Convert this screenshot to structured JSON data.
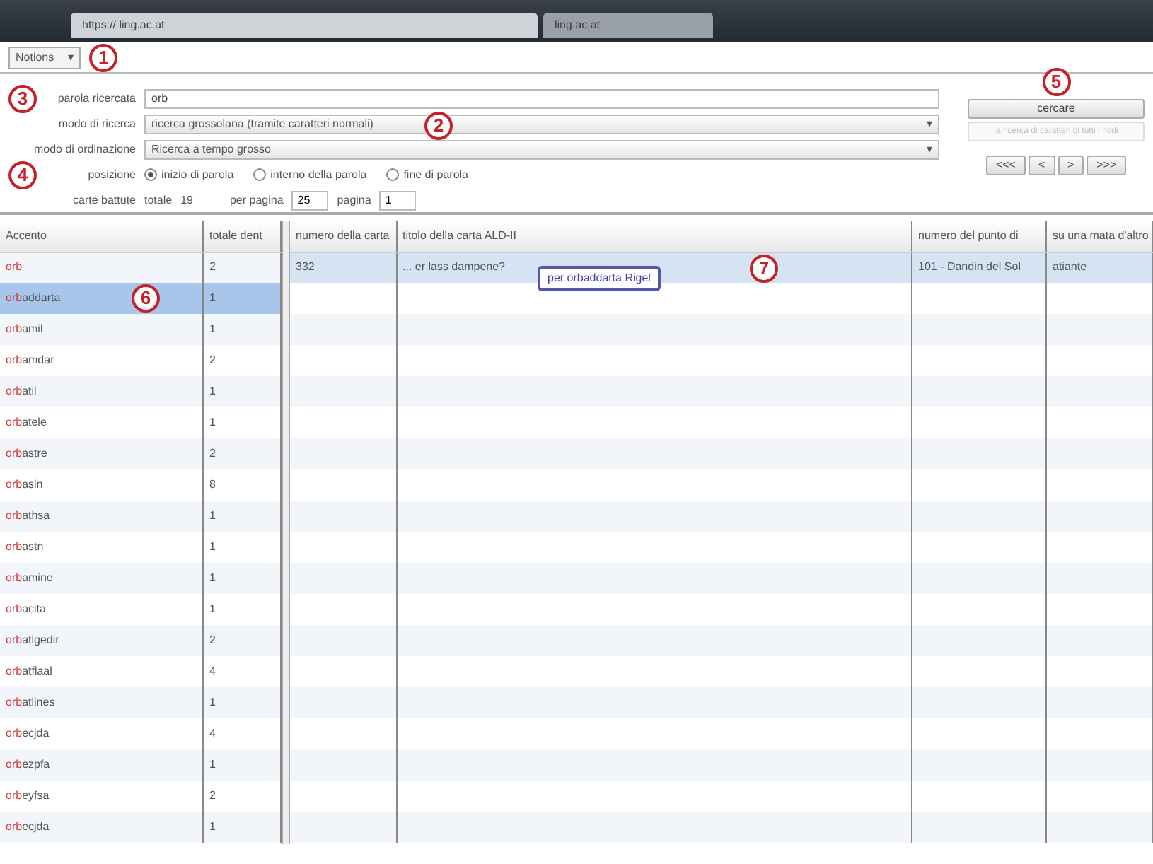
{
  "browser": {
    "tabs": [
      {
        "label": "https:// ling.ac.at",
        "selected": true
      },
      {
        "label": "ling.ac.at",
        "selected": false
      }
    ]
  },
  "menu": {
    "label": "Notions",
    "caret": "▾",
    "callout": "1"
  },
  "form": {
    "fields": [
      {
        "kind": "text",
        "label": "parola ricercata",
        "value": "orb",
        "callout": "3"
      },
      {
        "kind": "select",
        "label": "modo di ricerca",
        "value": "ricerca grossolana (tramite caratteri normali)",
        "caret": "▾",
        "callout": "2"
      },
      {
        "kind": "select",
        "label": "modo di ordinazione",
        "value": "Ricerca a tempo grosso",
        "caret": "▾"
      }
    ],
    "position": {
      "label": "posizione",
      "callout": "4",
      "options": [
        {
          "label": "inizio di parola",
          "selected": true
        },
        {
          "label": "interno della parola",
          "selected": false
        },
        {
          "label": "fine di parola",
          "selected": false
        }
      ]
    },
    "stats": {
      "label": "carte battute",
      "total_label": "totale",
      "total": "19",
      "per_page_label": "per pagina",
      "per_page": "25",
      "page_label": "pagina",
      "page": "1"
    },
    "search_button": {
      "label": "cercare",
      "callout": "5"
    },
    "secondary_button": {
      "label": "la ricerca di caratteri di tutti i nodi",
      "disabled": true
    },
    "pager": [
      "<<<",
      "<",
      ">",
      ">>>"
    ]
  },
  "words": {
    "columns": [
      "Accento",
      "totale dent"
    ],
    "callout": "6",
    "rows": [
      {
        "head": "orb",
        "tail": "",
        "count": "2",
        "selected": false
      },
      {
        "head": "orb",
        "tail": "addarta",
        "count": "1",
        "selected": true
      },
      {
        "head": "orb",
        "tail": "amil",
        "count": "1",
        "selected": false
      },
      {
        "head": "orb",
        "tail": "amdar",
        "count": "2",
        "selected": false
      },
      {
        "head": "orb",
        "tail": "atil",
        "count": "1",
        "selected": false
      },
      {
        "head": "orb",
        "tail": "atele",
        "count": "1",
        "selected": false
      },
      {
        "head": "orb",
        "tail": "astre",
        "count": "2",
        "selected": false
      },
      {
        "head": "orb",
        "tail": "asin",
        "count": "8",
        "selected": false
      },
      {
        "head": "orb",
        "tail": "athsa",
        "count": "1",
        "selected": false
      },
      {
        "head": "orb",
        "tail": "astn",
        "count": "1",
        "selected": false
      },
      {
        "head": "orb",
        "tail": "amine",
        "count": "1",
        "selected": false
      },
      {
        "head": "orb",
        "tail": "acita",
        "count": "1",
        "selected": false
      },
      {
        "head": "orb",
        "tail": "atlgedir",
        "count": "2",
        "selected": false
      },
      {
        "head": "orb",
        "tail": "atflaal",
        "count": "4",
        "selected": false
      },
      {
        "head": "orb",
        "tail": "atlines",
        "count": "1",
        "selected": false
      },
      {
        "head": "orb",
        "tail": "ecjda",
        "count": "4",
        "selected": false
      },
      {
        "head": "orb",
        "tail": "ezpfa",
        "count": "1",
        "selected": false
      },
      {
        "head": "orb",
        "tail": "eyfsa",
        "count": "2",
        "selected": false
      },
      {
        "head": "orb",
        "tail": "ecjda",
        "count": "1",
        "selected": false
      }
    ]
  },
  "cards": {
    "columns": [
      "numero della carta",
      "titolo della carta ALD-II",
      "numero del punto di",
      "su una mata d'altro"
    ],
    "callout": "7",
    "rows": [
      {
        "cells": [
          "332",
          "... er lass dampene?",
          "101 - Dandin del Sol",
          "atiante"
        ],
        "selected": true
      }
    ],
    "tooltip": "per orbaddarta Rigel"
  }
}
